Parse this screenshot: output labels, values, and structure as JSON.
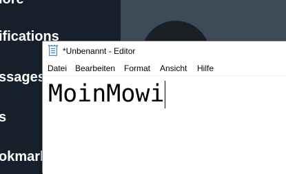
{
  "background_app": {
    "nav_items": [
      {
        "label": "lore"
      },
      {
        "label": "ifications"
      },
      {
        "label": "ssages"
      },
      {
        "label": "s"
      },
      {
        "label": "okmarks"
      }
    ]
  },
  "notepad": {
    "title": "*Unbenannt - Editor",
    "icon": "notepad-icon",
    "menu": {
      "datei": "Datei",
      "bearbeiten": "Bearbeiten",
      "format": "Format",
      "ansicht": "Ansicht",
      "hilfe": "Hilfe"
    },
    "content": "MoinMowi"
  }
}
